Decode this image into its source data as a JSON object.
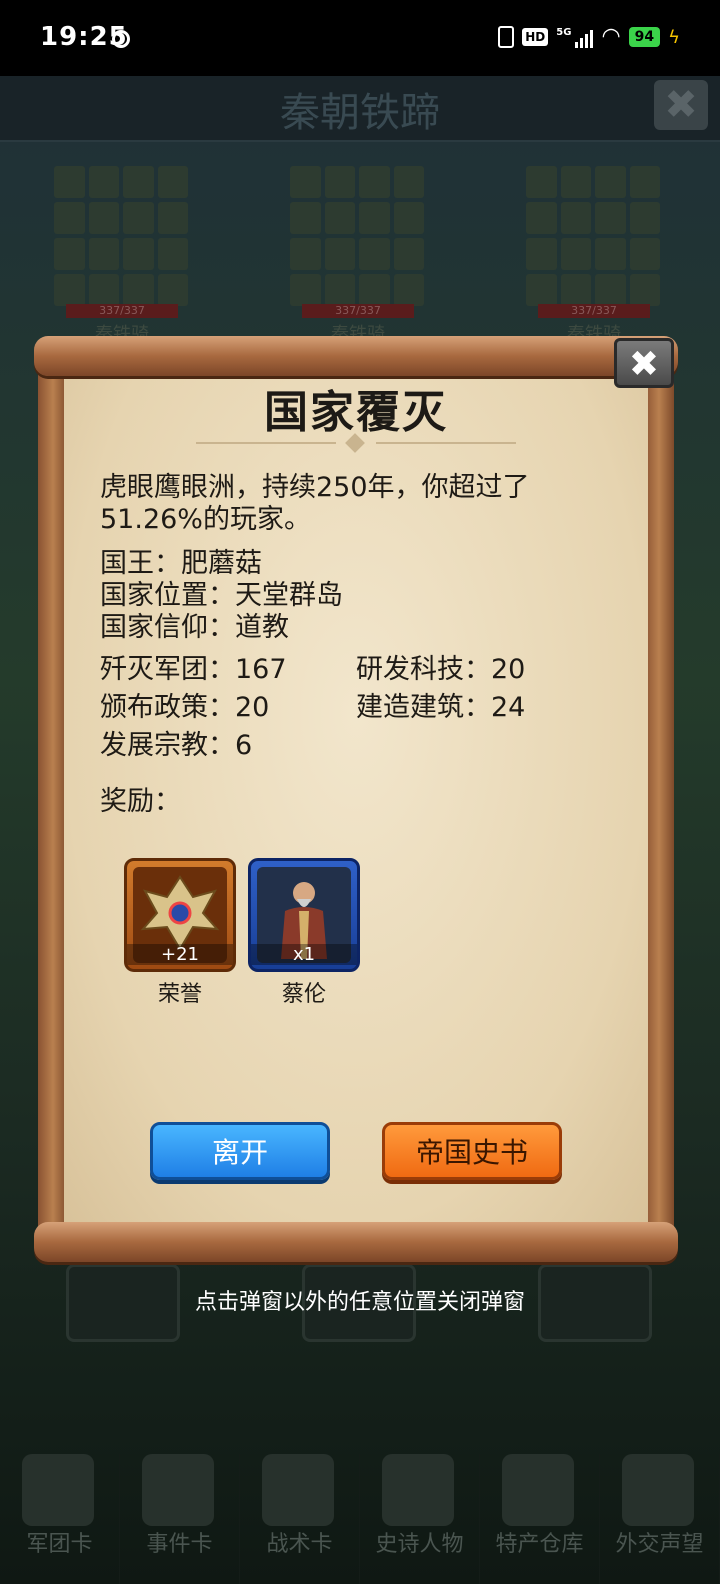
{
  "status_bar": {
    "time": "19:25",
    "network": "5G",
    "hd": "HD",
    "battery": "94"
  },
  "background": {
    "title": "秦朝铁蹄",
    "close": "✖",
    "army_count": "337/337",
    "army_name": "秦铁骑",
    "nav": [
      "军团卡",
      "事件卡",
      "战术卡",
      "史诗人物",
      "特产仓库",
      "外交声望"
    ]
  },
  "dialog": {
    "title": "国家覆灭",
    "close": "✖",
    "summary_line1": "虎眼鹰眼洲，持续250年，你超过了",
    "summary_line2": "51.26%的玩家。",
    "king": "国王：肥蘑菇",
    "location": "国家位置：天堂群岛",
    "religion": "国家信仰：道教",
    "stats": {
      "annihilated": "歼灭军团：167",
      "research": "研发科技：20",
      "policy": "颁布政策：20",
      "buildings": "建造建筑：24",
      "religions": "发展宗教：6"
    },
    "rewards_label": "奖励：",
    "rewards": [
      {
        "name": "荣誉",
        "qty": "+21",
        "icon": "honor-emblem-icon"
      },
      {
        "name": "蔡伦",
        "qty": "x1",
        "icon": "hero-portrait-icon"
      }
    ],
    "buttons": {
      "leave": "离开",
      "history": "帝国史书"
    }
  },
  "hint": "点击弹窗以外的任意位置关闭弹窗",
  "colors": {
    "paper": "#e6d4b0",
    "leave_button": "#2f95f0",
    "history_button": "#f37a22",
    "scroll_wood": "#a8693f"
  }
}
